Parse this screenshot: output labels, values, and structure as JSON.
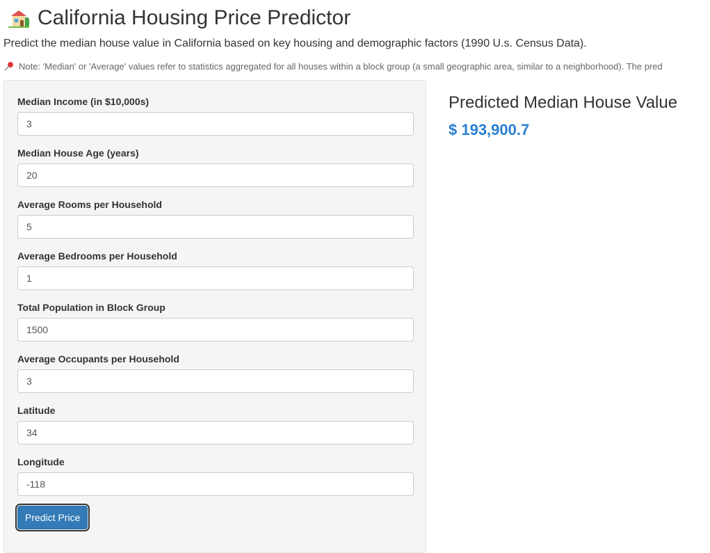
{
  "header": {
    "icon": "house-icon",
    "title": "California Housing Price Predictor",
    "subtitle": "Predict the median house value in California based on key housing and demographic factors (1990 U.s. Census Data).",
    "note_icon": "pushpin-icon",
    "note": "Note: 'Median' or 'Average' values refer to statistics aggregated for all houses within a block group (a small geographic area, similar to a neighborhood). The pred"
  },
  "form": {
    "fields": [
      {
        "label": "Median Income (in $10,000s)",
        "value": "3"
      },
      {
        "label": "Median House Age (years)",
        "value": "20"
      },
      {
        "label": "Average Rooms per Household",
        "value": "5"
      },
      {
        "label": "Average Bedrooms per Household",
        "value": "1"
      },
      {
        "label": "Total Population in Block Group",
        "value": "1500"
      },
      {
        "label": "Average Occupants per Household",
        "value": "3"
      },
      {
        "label": "Latitude",
        "value": "34"
      },
      {
        "label": "Longitude",
        "value": "-118"
      }
    ],
    "submit_label": "Predict Price"
  },
  "output": {
    "title": "Predicted Median House Value",
    "value": "$ 193,900.7"
  },
  "colors": {
    "accent": "#337ab7",
    "result": "#2a7fd0",
    "panel_bg": "#f5f5f5"
  }
}
